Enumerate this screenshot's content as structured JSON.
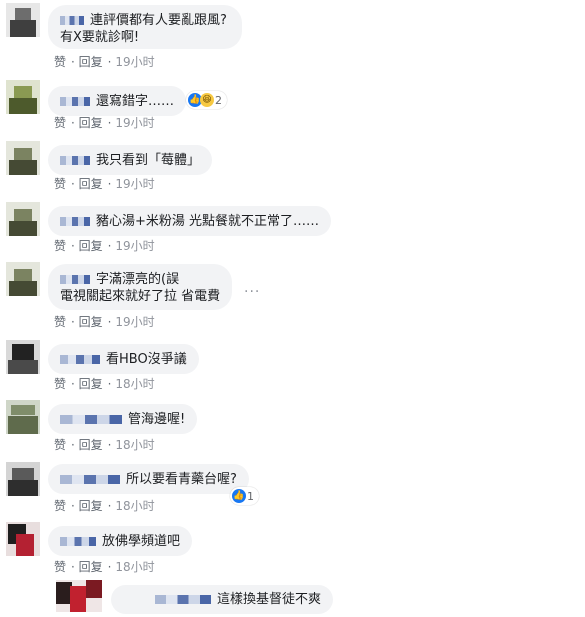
{
  "comments": [
    {
      "line1": "連評價都有人要亂跟風?",
      "line2": "有X要就診啊!",
      "like": "赞",
      "reply": "回复",
      "time": "19小时"
    },
    {
      "text": "還寫錯字……",
      "reaction_count": "2",
      "like": "赞",
      "reply": "回复",
      "time": "19小时"
    },
    {
      "text": "我只看到「莓體」",
      "like": "赞",
      "reply": "回复",
      "time": "19小时"
    },
    {
      "text": "豬心湯+米粉湯 光點餐就不正常了……",
      "like": "赞",
      "reply": "回复",
      "time": "19小时"
    },
    {
      "line1": "字滿漂亮的(誤",
      "line2": "電視關起來就好了拉 省電費",
      "like": "赞",
      "reply": "回复",
      "time": "19小时"
    },
    {
      "text": "看HBO沒爭議",
      "like": "赞",
      "reply": "回复",
      "time": "18小时"
    },
    {
      "text": "管海邊喔!",
      "like": "赞",
      "reply": "回复",
      "time": "18小时"
    },
    {
      "text": "所以要看青藥台喔?",
      "reaction_count": "1",
      "like": "赞",
      "reply": "回复",
      "time": "18小时"
    },
    {
      "text": "放佛學頻道吧",
      "like": "赞",
      "reply": "回复",
      "time": "18小时"
    }
  ],
  "reply": {
    "text": "這樣換基督徒不爽"
  },
  "more_dots": "···",
  "icons": {
    "like": "thumbs-up-icon",
    "haha": "haha-icon",
    "more": "more-options-icon"
  },
  "colors": {
    "bubble": "#f2f3f5",
    "like_blue": "#1877f2",
    "meta": "#606770"
  }
}
